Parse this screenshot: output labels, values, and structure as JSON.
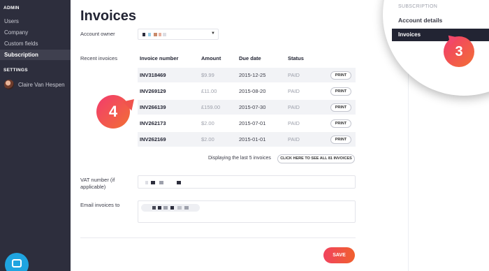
{
  "sidebar": {
    "section_admin": "ADMIN",
    "items": [
      "Users",
      "Company",
      "Custom fields",
      "Subscription"
    ],
    "active_item": "Subscription",
    "section_settings": "SETTINGS",
    "user_name": "Claire Van Hespen"
  },
  "main": {
    "title": "Invoices",
    "account_owner_label": "Account owner",
    "recent_invoices_label": "Recent invoices",
    "table": {
      "headers": [
        "Invoice number",
        "Amount",
        "Due date",
        "Status"
      ],
      "rows": [
        {
          "number": "INV318469",
          "amount": "$9.99",
          "due": "2015-12-25",
          "status": "PAID",
          "action": "PRINT"
        },
        {
          "number": "INV269129",
          "amount": "£11.00",
          "due": "2015-08-20",
          "status": "PAID",
          "action": "PRINT"
        },
        {
          "number": "INV266139",
          "amount": "£159.00",
          "due": "2015-07-30",
          "status": "PAID",
          "action": "PRINT"
        },
        {
          "number": "INV262173",
          "amount": "$2.00",
          "due": "2015-07-01",
          "status": "PAID",
          "action": "PRINT"
        },
        {
          "number": "INV262169",
          "amount": "$2.00",
          "due": "2015-01-01",
          "status": "PAID",
          "action": "PRINT"
        }
      ]
    },
    "footnote": "Displaying the last 5 invoices",
    "see_all_button": "CLICK HERE TO SEE ALL 81 INVOICES",
    "vat_label": "VAT number (if applicable)",
    "email_label": "Email invoices to",
    "save_button": "SAVE"
  },
  "magnifier": {
    "section_label": "SUBSCRIPTION",
    "item_account_details": "Account details",
    "item_invoices": "Invoices"
  },
  "badges": {
    "step3": "3",
    "step4": "4"
  },
  "colors": {
    "sidebar_bg": "#2d2e3d",
    "accent_gradient_start": "#f1435e",
    "accent_gradient_end": "#f0602e",
    "active_dark": "#222433"
  }
}
